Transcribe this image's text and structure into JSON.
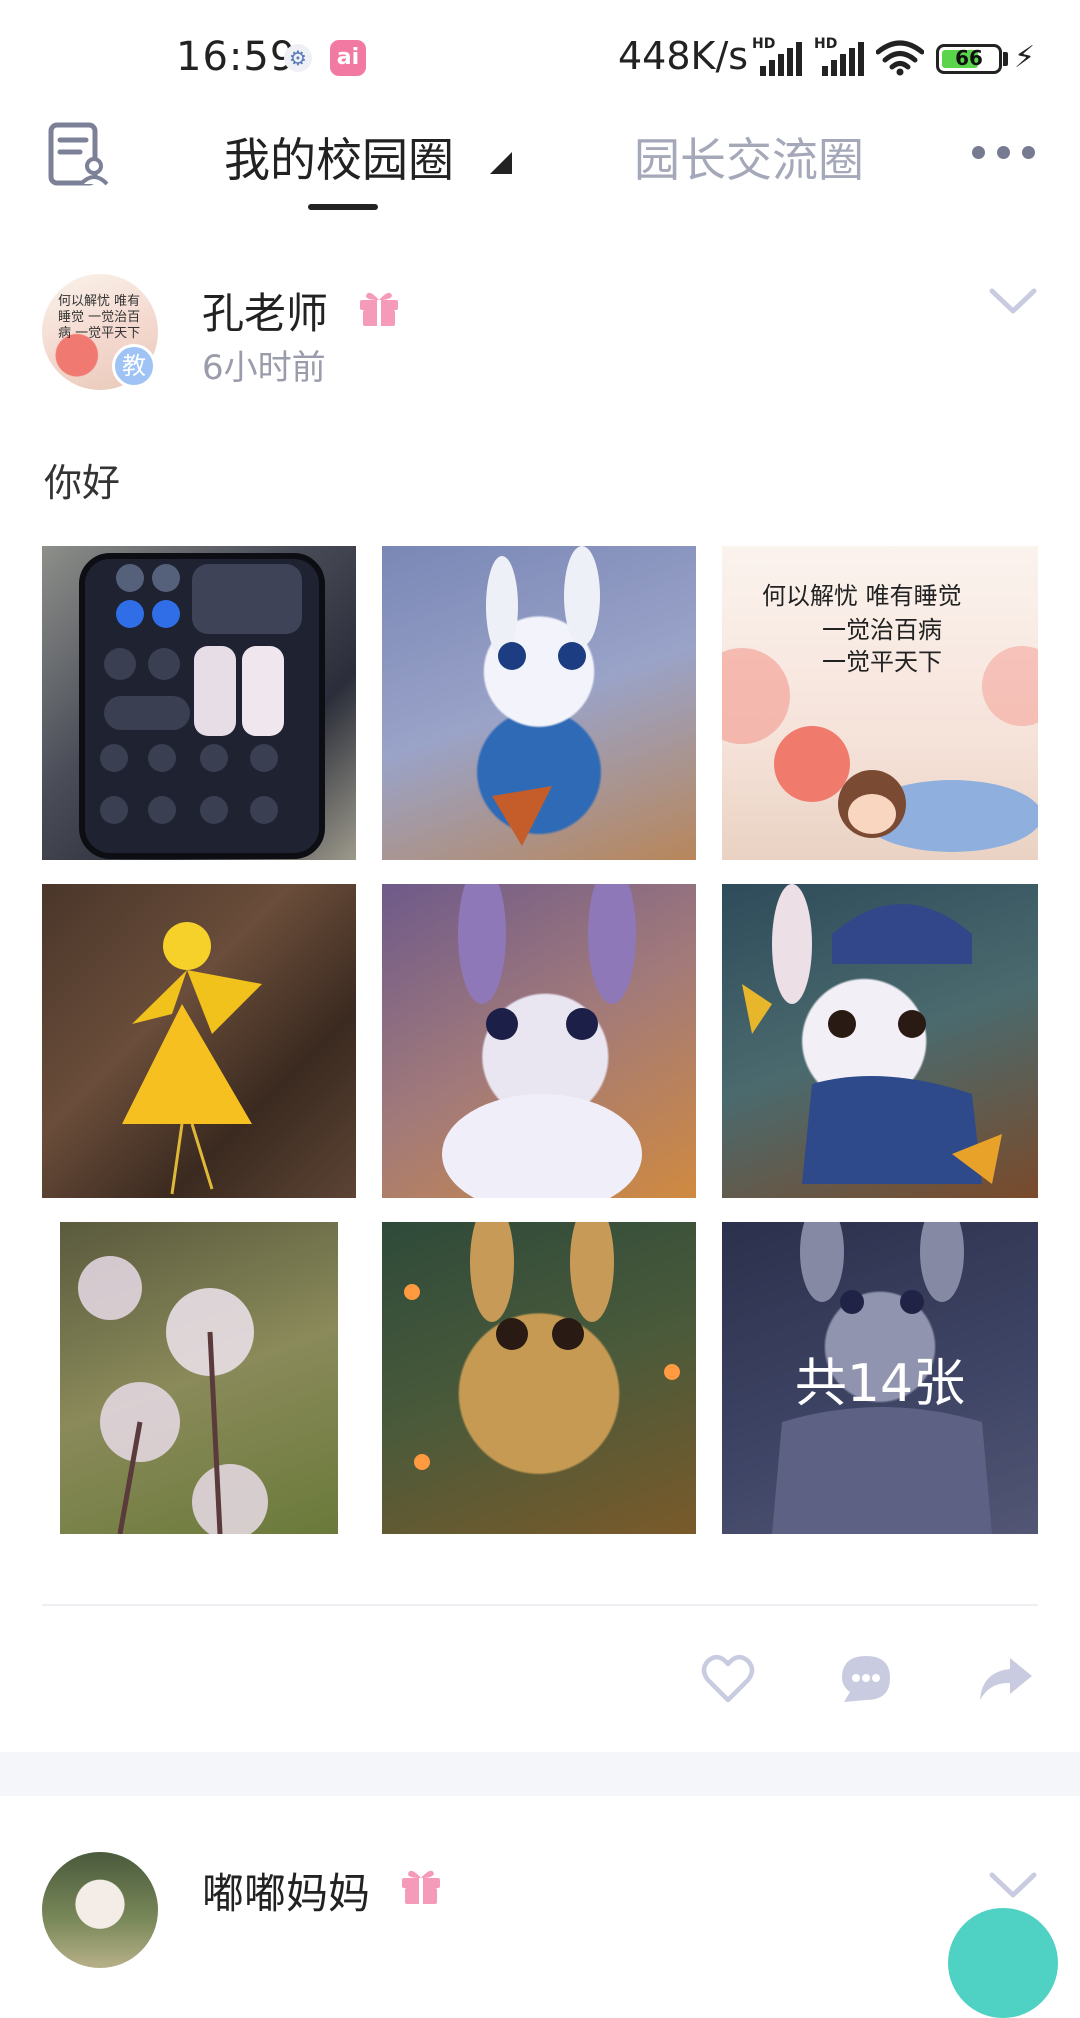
{
  "status_bar": {
    "time": "16:59",
    "ai_badge": "ai",
    "net_speed": "448K/s",
    "signal_label": "HD",
    "battery": "66",
    "battery_level": 0.66,
    "icons": [
      "settings-icon",
      "ai-app-icon",
      "signal-icon",
      "wifi-icon",
      "battery-icon",
      "charging-icon"
    ]
  },
  "header": {
    "left_icon": "profile-document-icon",
    "tab_active": "我的校园圈",
    "tab_other": "园长交流圈",
    "more_icon": "more-dots-icon"
  },
  "post": {
    "author": "孔老师",
    "role_badge": "教",
    "time": "6小时前",
    "text": "你好",
    "avatar_text": "何以解忧 唯有睡觉 一觉治百病 一觉平天下",
    "images": [
      {
        "label": "phone-control-center",
        "color": "#3a3d4c"
      },
      {
        "label": "blue-hoodie-bunny",
        "color": "#6d7fb8"
      },
      {
        "label": "sleep-quote-cartoon",
        "color": "#f6e7dc"
      },
      {
        "label": "ginkgo-leaf-dancer",
        "color": "#5b4334"
      },
      {
        "label": "purple-bunny",
        "color": "#9a7fb0"
      },
      {
        "label": "knit-hat-bunny",
        "color": "#3f5a6c"
      },
      {
        "label": "dandelions",
        "color": "#6d7a4a"
      },
      {
        "label": "golden-bunny",
        "color": "#7a6a3a"
      },
      {
        "label": "sweater-bunny",
        "color": "#4c5478"
      }
    ],
    "more_count_label": "共14张",
    "image_quote": "何以解忧 唯有睡觉 一觉治百病 一觉平天下",
    "actions": [
      "like-icon",
      "comment-icon",
      "share-icon"
    ]
  },
  "post2": {
    "author": "嘟嘟妈妈"
  },
  "colors": {
    "accent_pink": "#f59ab8",
    "muted_icon": "#c9cbe0",
    "teal_fab": "#4fd2c3"
  }
}
